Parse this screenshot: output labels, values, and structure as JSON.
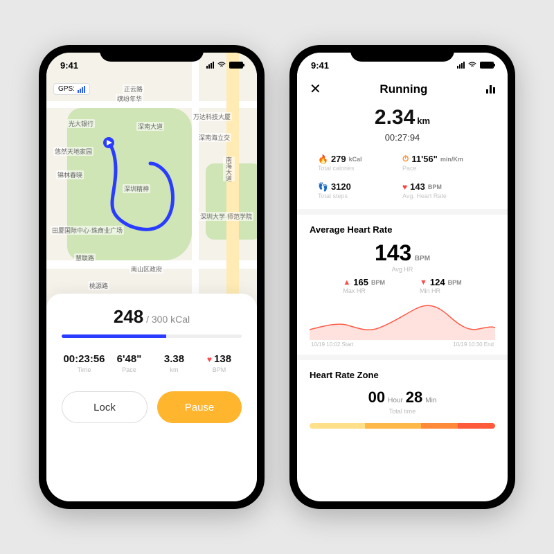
{
  "status": {
    "time": "9:41"
  },
  "left": {
    "gps_label": "GPS:",
    "map_labels": [
      "正云路",
      "缤纷年华",
      "光大银行",
      "深南大道",
      "深南海立交",
      "万达科技大厦",
      "悠然天地家园",
      "南海大道",
      "慧联路",
      "锦林春晓",
      "深圳精神",
      "深圳大学·师范学院",
      "南山区政府",
      "桃源路",
      "田厦国际中心·珠商业广场"
    ],
    "calories": {
      "current": "248",
      "target": "/ 300 kCal",
      "progress_pct": 58
    },
    "metrics": [
      {
        "value": "00:23:56",
        "label": "Time"
      },
      {
        "value": "6'48\"",
        "label": "Pace"
      },
      {
        "value": "3.38",
        "label": "km"
      },
      {
        "value": "138",
        "label": "BPM",
        "icon": "heart"
      }
    ],
    "buttons": {
      "lock": "Lock",
      "pause": "Pause"
    }
  },
  "right": {
    "title": "Running",
    "distance": {
      "value": "2.34",
      "unit": "km"
    },
    "duration": "00:27:94",
    "stats": [
      {
        "icon": "flame",
        "value": "279",
        "unit": "kCal",
        "label": "Total calories"
      },
      {
        "icon": "clock",
        "value": "11'56\"",
        "unit": "min/Km",
        "label": "Pace"
      },
      {
        "icon": "steps",
        "value": "3120",
        "unit": "",
        "label": "Total steps"
      },
      {
        "icon": "heart",
        "value": "143",
        "unit": "BPM",
        "label": "Avg. Heart Rate"
      }
    ],
    "avg_hr": {
      "title": "Average Heart Rate",
      "value": "143",
      "unit": "BPM",
      "sub": "Avg HR",
      "max": {
        "value": "165",
        "unit": "BPM",
        "label": "Max HR"
      },
      "min": {
        "value": "124",
        "unit": "BPM",
        "label": "Min HR"
      },
      "x_start": "10/19  10:02 Start",
      "x_end": "10/19  10:30 End"
    },
    "zone": {
      "title": "Heart Rate Zone",
      "hours": "00",
      "hours_unit": "Hour",
      "mins": "28",
      "mins_unit": "Min",
      "sub": "Total time"
    }
  },
  "chart_data": {
    "type": "line",
    "title": "Average Heart Rate",
    "ylabel": "BPM",
    "ylim": [
      100,
      170
    ],
    "x": [
      0,
      1,
      2,
      3,
      4,
      5,
      6,
      7,
      8,
      9,
      10,
      11,
      12,
      13,
      14
    ],
    "series": [
      {
        "name": "Heart Rate",
        "values": [
          120,
          126,
          132,
          138,
          130,
          125,
          140,
          150,
          158,
          165,
          155,
          142,
          130,
          124,
          128
        ]
      }
    ],
    "x_start": "10/19 10:02 Start",
    "x_end": "10/19 10:30 End"
  }
}
